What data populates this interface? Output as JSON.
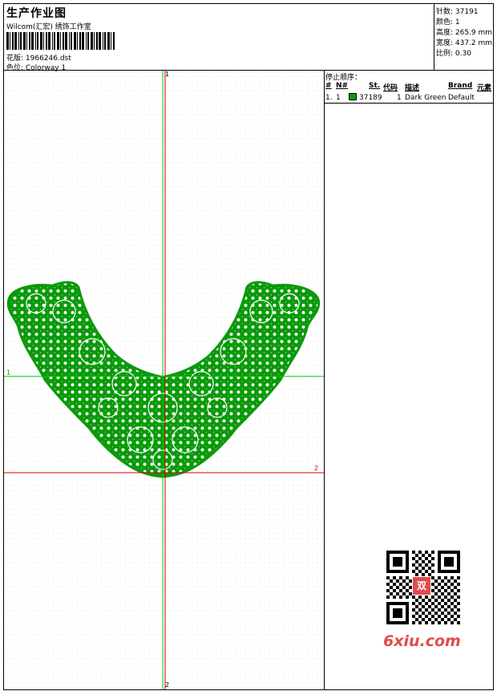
{
  "header": {
    "title": "生产作业图",
    "subtitle": "Wilcom(汇宏) 绣饰工作室",
    "design_label": "花版: 1966246.dst",
    "colorway_label": "色位:  Colorway 1"
  },
  "stats": [
    "针数: 37191",
    "颜色: 1",
    "高度: 265.9 mm",
    "宽度: 437.2 mm",
    "比例: 0.30"
  ],
  "guides": {
    "v_top": "1",
    "v_bottom": "2",
    "h_green": "1",
    "h_red": "2"
  },
  "thread_panel": {
    "stop_sequence_label": "停止顺序：",
    "columns": [
      "#",
      "N#",
      "St.",
      "代码",
      "描述",
      "Brand",
      "元素"
    ],
    "rows": [
      {
        "index": "1.",
        "n": "1",
        "stitches": "37189",
        "code": "1",
        "description": "Dark Green",
        "brand": "Default",
        "element": ""
      }
    ]
  },
  "watermark": {
    "logo_text": "双",
    "site": "6xiu.com"
  },
  "colors": {
    "thread": "#0a9a0a",
    "green_guide": "#00c800",
    "red_guide": "#d40000"
  }
}
